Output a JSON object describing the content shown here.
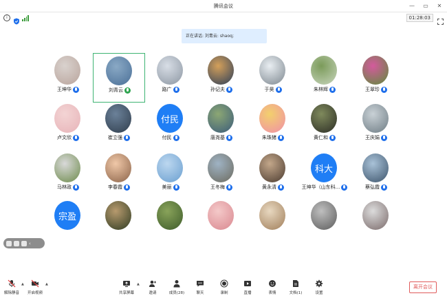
{
  "window": {
    "title": "腾讯会议"
  },
  "status": {
    "timer": "01:28:03"
  },
  "speaking_banner": "正在讲话: 刘青云: shaoq;",
  "participants": [
    {
      "name": "王坤华",
      "avatar_type": "photo",
      "colors": [
        "#d9d2ce",
        "#b9a49c"
      ],
      "active": false,
      "mic": "muted"
    },
    {
      "name": "刘青云",
      "avatar_type": "photo",
      "colors": [
        "#8aa9c5",
        "#4a6f97"
      ],
      "active": true,
      "mic": "live"
    },
    {
      "name": "路广",
      "avatar_type": "photo",
      "colors": [
        "#d8dee6",
        "#8c96a2"
      ],
      "active": false,
      "mic": "muted"
    },
    {
      "name": "孙记夫",
      "avatar_type": "photo",
      "colors": [
        "#d4a05a",
        "#2c3e59"
      ],
      "active": false,
      "mic": "muted"
    },
    {
      "name": "于昊",
      "avatar_type": "photo",
      "colors": [
        "#e9eef2",
        "#7d878f"
      ],
      "active": false,
      "mic": "muted"
    },
    {
      "name": "朱林辉",
      "avatar_type": "photo",
      "colors": [
        "#7b9b5a",
        "#c8d5bd"
      ],
      "active": false,
      "mic": "muted"
    },
    {
      "name": "王翠珍",
      "avatar_type": "photo",
      "colors": [
        "#d45a9d",
        "#5e8c3a"
      ],
      "active": false,
      "mic": "muted"
    },
    {
      "name": "卢文欣",
      "avatar_type": "photo",
      "colors": [
        "#f3d4d4",
        "#e7b3b8"
      ],
      "active": false,
      "mic": "muted"
    },
    {
      "name": "崔立强",
      "avatar_type": "photo",
      "colors": [
        "#6b8199",
        "#2f3d4c"
      ],
      "active": false,
      "mic": "muted"
    },
    {
      "name": "付民",
      "avatar_type": "text",
      "initials": "付民",
      "active": false,
      "mic": "muted"
    },
    {
      "name": "唐尧基",
      "avatar_type": "photo",
      "colors": [
        "#8ca774",
        "#3a5b7a"
      ],
      "active": false,
      "mic": "muted"
    },
    {
      "name": "朱珠猪",
      "avatar_type": "photo",
      "colors": [
        "#f3d06d",
        "#f08fa8"
      ],
      "active": false,
      "mic": "muted"
    },
    {
      "name": "黄仁和",
      "avatar_type": "photo",
      "colors": [
        "#7f8a5c",
        "#2c2d25"
      ],
      "active": false,
      "mic": "muted"
    },
    {
      "name": "王庆娟",
      "avatar_type": "photo",
      "colors": [
        "#c9d1d6",
        "#6e7c84"
      ],
      "active": false,
      "mic": "muted"
    },
    {
      "name": "马林政",
      "avatar_type": "photo",
      "colors": [
        "#d9d9d9",
        "#6c8a4a"
      ],
      "active": false,
      "mic": "muted"
    },
    {
      "name": "李春霞",
      "avatar_type": "photo",
      "colors": [
        "#f0c8a8",
        "#8a6248"
      ],
      "active": false,
      "mic": "muted"
    },
    {
      "name": "美丽",
      "avatar_type": "photo",
      "colors": [
        "#bcd7ef",
        "#6a9fd0"
      ],
      "active": false,
      "mic": "muted"
    },
    {
      "name": "王冬梅",
      "avatar_type": "photo",
      "colors": [
        "#9fb3c4",
        "#6c6a5e"
      ],
      "active": false,
      "mic": "muted"
    },
    {
      "name": "黄永清",
      "avatar_type": "photo",
      "colors": [
        "#c3a78a",
        "#4b3b30"
      ],
      "active": false,
      "mic": "muted"
    },
    {
      "name": "王坤华（山东科...",
      "avatar_type": "text",
      "initials": "科大",
      "active": false,
      "mic": "muted"
    },
    {
      "name": "蔡弘霞",
      "avatar_type": "photo",
      "colors": [
        "#a9c2d8",
        "#3c536a"
      ],
      "active": false,
      "mic": "muted"
    },
    {
      "name": "",
      "avatar_type": "text",
      "initials": "宗盈",
      "active": false,
      "mic": "none"
    },
    {
      "name": "",
      "avatar_type": "photo",
      "colors": [
        "#b79a6e",
        "#2e3b22"
      ],
      "active": false,
      "mic": "none"
    },
    {
      "name": "",
      "avatar_type": "photo",
      "colors": [
        "#89a35a",
        "#3d5b2a"
      ],
      "active": false,
      "mic": "none"
    },
    {
      "name": "",
      "avatar_type": "photo",
      "colors": [
        "#f4c9c9",
        "#d9878f"
      ],
      "active": false,
      "mic": "none"
    },
    {
      "name": "",
      "avatar_type": "photo",
      "colors": [
        "#e8d8c0",
        "#a07e5a"
      ],
      "active": false,
      "mic": "none"
    },
    {
      "name": "",
      "avatar_type": "photo",
      "colors": [
        "#bfbfbf",
        "#5c5c5c"
      ],
      "active": false,
      "mic": "none"
    },
    {
      "name": "",
      "avatar_type": "photo",
      "colors": [
        "#dcdcdc",
        "#7a6a6a"
      ],
      "active": false,
      "mic": "none"
    }
  ],
  "toolbar": {
    "unmute": "解除静音",
    "video": "开启视频",
    "share": "共享屏幕",
    "invite": "邀请",
    "members": "成员(28)",
    "chat": "聊天",
    "record": "录制",
    "live": "直播",
    "reactions": "表情",
    "docs": "文档(1)",
    "settings": "设置",
    "leave": "离开会议"
  }
}
